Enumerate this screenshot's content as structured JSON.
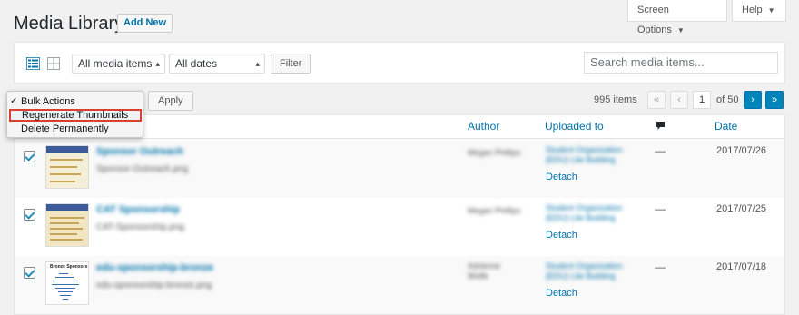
{
  "header": {
    "title": "Media Library",
    "add_new_label": "Add New"
  },
  "tabs": {
    "screen_options": "Screen Options",
    "help": "Help",
    "caret": "▼"
  },
  "filters": {
    "type_select": "All media items",
    "date_select": "All dates",
    "filter_button": "Filter",
    "search_placeholder": "Search media items..."
  },
  "bulk": {
    "options": [
      {
        "label": "Bulk Actions",
        "selected": true
      },
      {
        "label": "Regenerate Thumbnails",
        "selected": false,
        "highlighted": true
      },
      {
        "label": "Delete Permanently",
        "selected": false
      }
    ],
    "apply_label": "Apply"
  },
  "pagination": {
    "count": "995 items",
    "first": "«",
    "prev": "‹",
    "current_page": "1",
    "of_label": "of 50",
    "next": "›",
    "last": "»"
  },
  "columns": {
    "author": "Author",
    "uploaded_to": "Uploaded to",
    "date": "Date"
  },
  "rows": [
    {
      "title": "Sponsor Outreach",
      "file": "Sponsor-Outreach.png",
      "author": "Megan Phillips",
      "uploaded_line1": "Student Organization",
      "uploaded_line2": "(EDU) Lite Building",
      "detach": "Detach",
      "comments": "—",
      "date": "2017/07/26"
    },
    {
      "title": "CAT Sponsorship",
      "file": "CAT-Sponsorship.png",
      "author": "Megan Phillips",
      "uploaded_line1": "Student Organization",
      "uploaded_line2": "(EDU) Lite Building",
      "detach": "Detach",
      "comments": "—",
      "date": "2017/07/25"
    },
    {
      "title": "edu-sponsorship-bronze",
      "file": "edu-sponsorship-bronze.png",
      "author_line1": "Adrienne",
      "author_line2": "Wolfe",
      "uploaded_line1": "Student Organization",
      "uploaded_line2": "(EDU) Lite Building",
      "detach": "Detach",
      "comments": "—",
      "date": "2017/07/18"
    }
  ],
  "thumb_c_title": "Bronze Sponsors"
}
